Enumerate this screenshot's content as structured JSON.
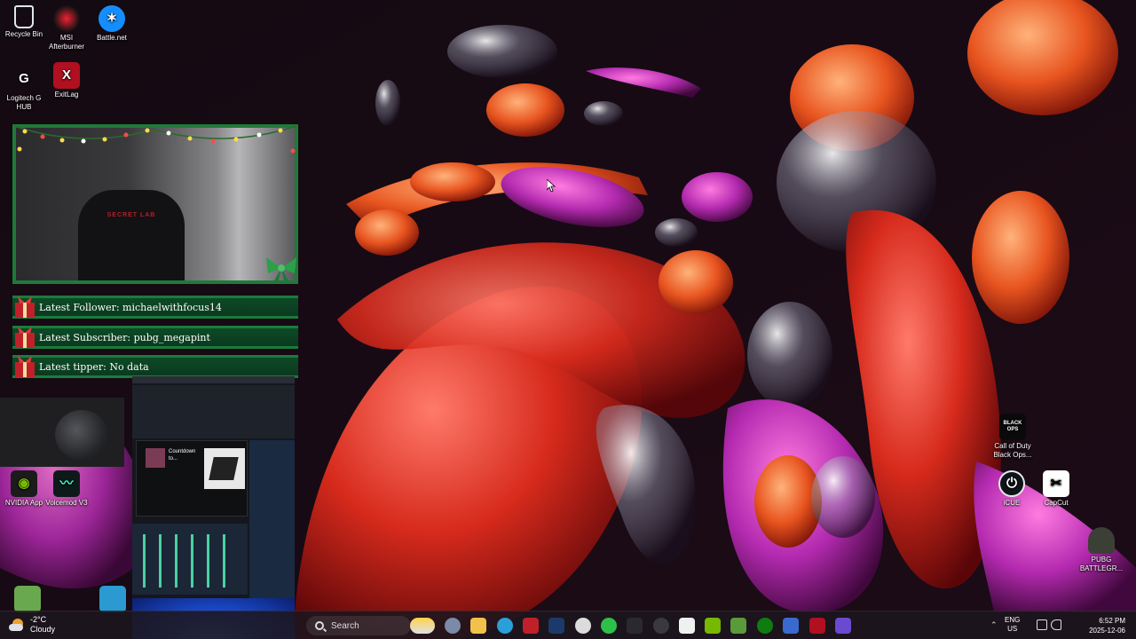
{
  "desktop": {
    "icons_left": [
      {
        "label": "Recycle Bin",
        "icon": "recycle-bin-icon"
      },
      {
        "label": "MSI Afterburner",
        "icon": "msi-afterburner-icon"
      },
      {
        "label": "Battle.net",
        "icon": "battlenet-icon"
      },
      {
        "label": "Logitech G HUB",
        "icon": "logitech-g-hub-icon"
      },
      {
        "label": "ExitLag",
        "icon": "exitlag-icon"
      },
      {
        "label": "NVIDIA App",
        "icon": "nvidia-icon"
      },
      {
        "label": "Voicemod V3",
        "icon": "voicemod-icon"
      }
    ],
    "icons_right": [
      {
        "label": "Call of Duty Black Ops...",
        "icon": "call-of-duty-icon",
        "badge": "BLACK OPS"
      },
      {
        "label": "iCUE",
        "icon": "icue-icon"
      },
      {
        "label": "CapCut",
        "icon": "capcut-icon"
      },
      {
        "label": "PUBG BATTLEGR...",
        "icon": "pubg-icon"
      }
    ]
  },
  "overlay": {
    "webcam_brand": "SECRET LAB",
    "latest_follower": "Latest Follower: michaelwithfocus14",
    "latest_subscriber": "Latest Subscriber: pubg_megapint",
    "latest_tipper": "Latest tipper: No data",
    "capture_song": "Countdown to..."
  },
  "taskbar": {
    "weather_temp": "-2°C",
    "weather_desc": "Cloudy",
    "search_placeholder": "Search",
    "language_line1": "ENG",
    "language_line2": "US",
    "time": "6:52 PM",
    "date": "2025-12-06",
    "pinned_apps": [
      "weather-widget-icon",
      "settings-icon",
      "file-explorer-icon",
      "edge-icon",
      "game-icon",
      "steam-icon",
      "steelseries-icon",
      "xbox-icon",
      "logitech-icon",
      "obs-icon",
      "capcut-icon",
      "nvidia-icon",
      "minecraft-icon",
      "xbox-app-icon",
      "terminal-icon",
      "exitlag-icon",
      "app-icon"
    ]
  },
  "colors": {
    "overlay_green": "#1a7c3c",
    "overlay_red": "#c0303a",
    "taskbar_bg": "#1c161e"
  }
}
